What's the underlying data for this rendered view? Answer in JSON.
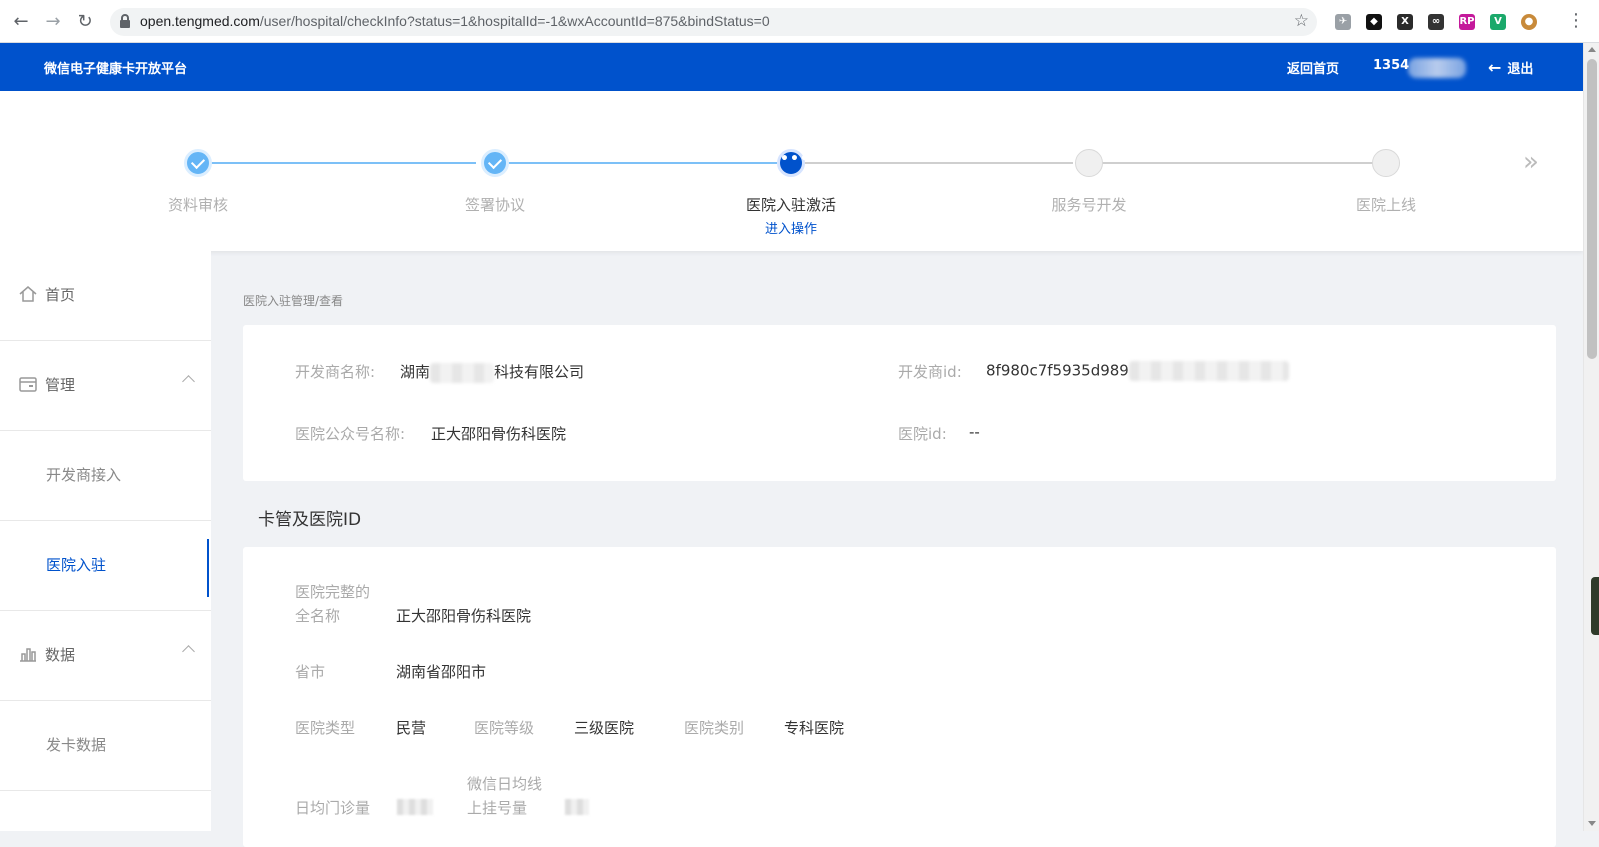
{
  "browser": {
    "url_domain": "open.tengmed.com",
    "url_path": "/user/hospital/checkInfo?status=1&hospitalId=-1&wxAccountId=875&bindStatus=0",
    "back_icon": "arrow-left-icon",
    "forward_icon": "arrow-right-icon",
    "reload_icon": "reload-icon",
    "extensions": [
      {
        "name": "bird-extension-icon",
        "color": "#9aa0a6",
        "glyph": "✈"
      },
      {
        "name": "puzzle-extension-icon",
        "color": "#111111",
        "glyph": "◆"
      },
      {
        "name": "x-extension-icon",
        "color": "#2b2b2b",
        "glyph": "X"
      },
      {
        "name": "glasses-extension-icon",
        "color": "#333333",
        "glyph": "∞"
      },
      {
        "name": "rp-extension-icon",
        "color": "#c4199b",
        "glyph": "RP"
      },
      {
        "name": "vue-devtools-icon",
        "color": "#1ba96b",
        "glyph": "V"
      },
      {
        "name": "burger-extension-icon",
        "color": "#c88a3a",
        "glyph": "●"
      }
    ]
  },
  "header": {
    "brand": "微信电子健康卡开放平台",
    "home_link": "返回首页",
    "phone_visible": "1354",
    "logout": "退出"
  },
  "steps": [
    {
      "label": "资料审核",
      "state": "done"
    },
    {
      "label": "签署协议",
      "state": "done"
    },
    {
      "label": "医院入驻激活",
      "state": "active",
      "sub": "进入操作",
      "dot_glyph": "•••"
    },
    {
      "label": "服务号开发",
      "state": "pending"
    },
    {
      "label": "医院上线",
      "state": "pending"
    }
  ],
  "steps_more": "»",
  "sidebar": {
    "items": [
      {
        "label": "首页",
        "icon": "home-icon"
      },
      {
        "label": "管理",
        "icon": "wallet-icon"
      },
      {
        "label": "开发商接入"
      },
      {
        "label": "医院入驻"
      },
      {
        "label": "数据",
        "icon": "bar-chart-icon"
      },
      {
        "label": "发卡数据"
      }
    ]
  },
  "breadcrumb": "医院入驻管理/查看",
  "developer_card": {
    "name_key": "开发商名称:",
    "name_prefix": "湖南",
    "name_suffix": "科技有限公司",
    "id_key": "开发商id:",
    "id_value": "8f980c7f5935d989",
    "account_key": "医院公众号名称:",
    "account_value": "正大邵阳骨伤科医院",
    "hospital_id_key": "医院id:",
    "hospital_id_value": "--"
  },
  "section_title": "卡管及医院ID",
  "hospital_card": {
    "fullname_key_1": "医院完整的",
    "fullname_key_2": "全名称",
    "fullname_value": "正大邵阳骨伤科医院",
    "region_key": "省市",
    "region_value": "湖南省邵阳市",
    "type_key": "医院类型",
    "type_value": "民营",
    "level_key": "医院等级",
    "level_value": "三级医院",
    "category_key": "医院类别",
    "category_value": "专科医院",
    "daily_visits_key": "日均门诊量",
    "wechat_reg_key_1": "微信日均线",
    "wechat_reg_key_2": "上挂号量"
  },
  "colors": {
    "brand_blue": "#0052cc",
    "step_done": "#64b5f6",
    "page_bg": "#f0f2f5"
  }
}
